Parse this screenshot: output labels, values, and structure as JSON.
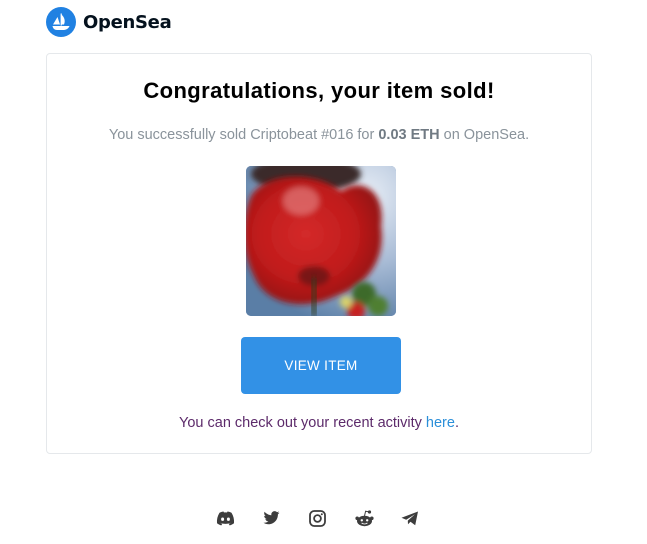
{
  "header": {
    "brand_name": "OpenSea",
    "brand_color": "#2081e2"
  },
  "card": {
    "headline": "Congratulations, your item sold!",
    "message_prefix": "You successfully sold Criptobeat #016 for ",
    "price": "0.03 ETH",
    "message_suffix": " on OpenSea.",
    "item_image_description_icon": "nft-image",
    "view_button_label": "VIEW ITEM",
    "view_button_color": "#3291e6",
    "activity_text": "You can check out your recent activity ",
    "activity_link": "here",
    "activity_suffix": "."
  },
  "footer": {
    "socials": [
      {
        "icon": "discord-icon"
      },
      {
        "icon": "twitter-icon"
      },
      {
        "icon": "instagram-icon"
      },
      {
        "icon": "reddit-icon"
      },
      {
        "icon": "telegram-icon"
      }
    ],
    "icon_color": "#3d3d3d"
  }
}
